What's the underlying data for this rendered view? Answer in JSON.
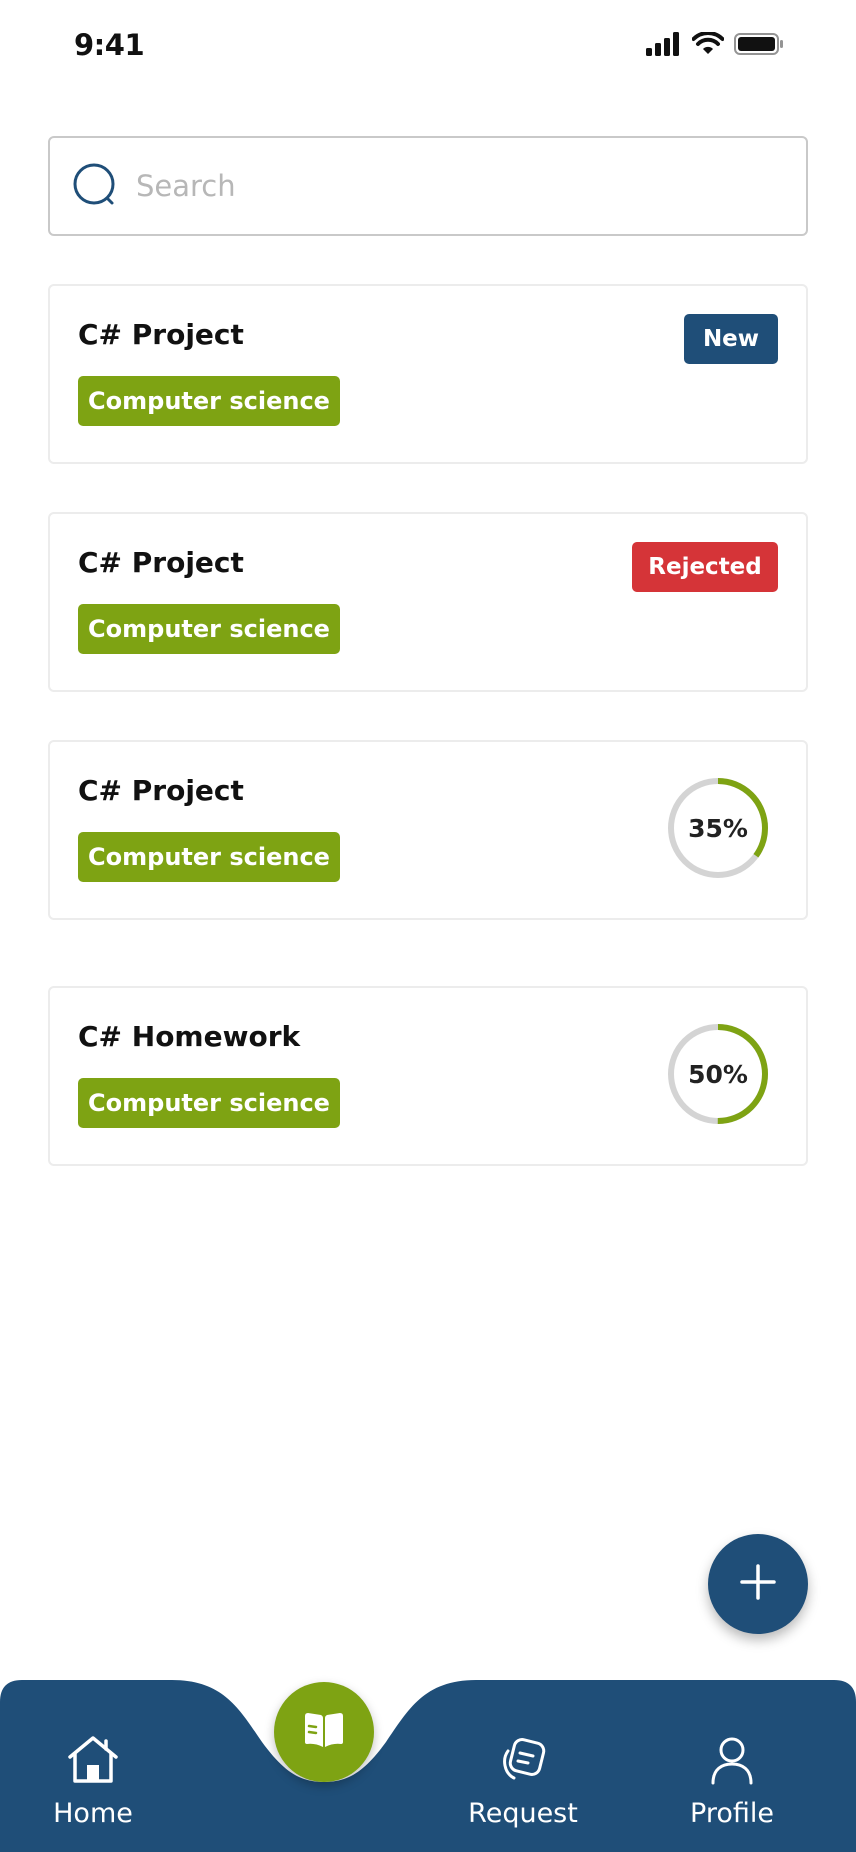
{
  "status_bar": {
    "time": "9:41"
  },
  "search": {
    "placeholder": "Search",
    "value": ""
  },
  "cards": [
    {
      "title": "C# Project",
      "tag": "Computer science",
      "status": "New"
    },
    {
      "title": "C# Project",
      "tag": "Computer science",
      "status": "Rejected"
    },
    {
      "title": "C# Project",
      "tag": "Computer science",
      "progress": 35,
      "progress_label": "35%"
    },
    {
      "title": "C# Homework",
      "tag": "Computer science",
      "progress": 50,
      "progress_label": "50%"
    }
  ],
  "fab": {
    "icon": "plus-icon"
  },
  "bottom_nav": {
    "items": [
      {
        "label": "Home",
        "icon": "home-icon",
        "active": true
      },
      {
        "label": "",
        "icon": "book-icon",
        "center": true
      },
      {
        "label": "Request",
        "icon": "request-icon"
      },
      {
        "label": "Profile",
        "icon": "profile-icon"
      }
    ]
  },
  "colors": {
    "primary": "#1f4e78",
    "accent": "#7ea313",
    "rejected": "#d53438",
    "progress_track": "#d4d4d4"
  }
}
